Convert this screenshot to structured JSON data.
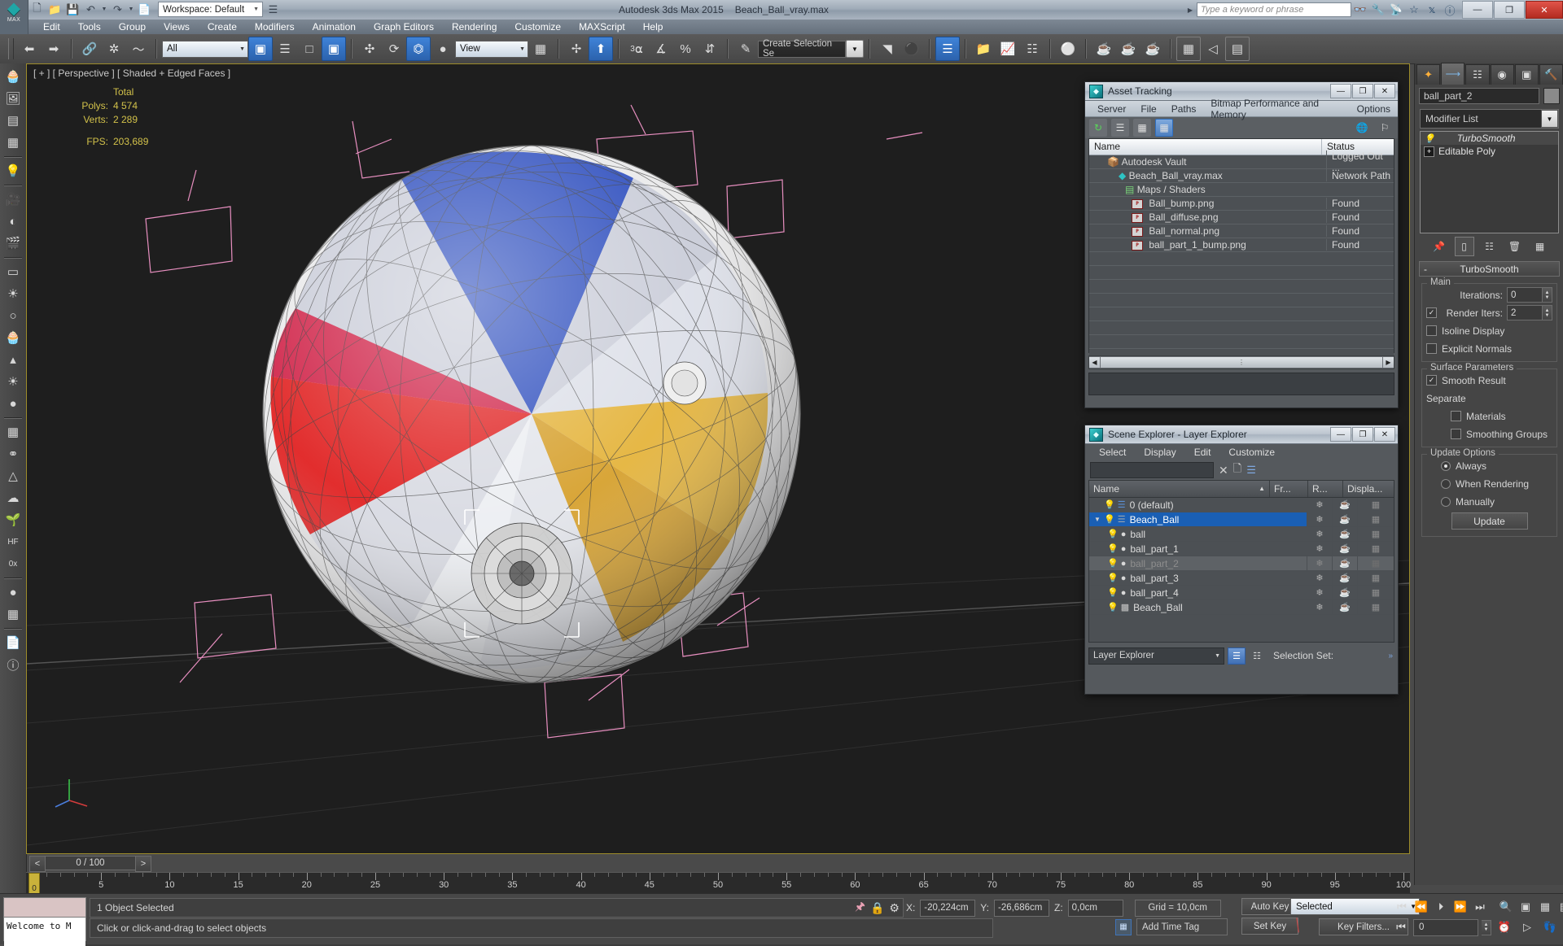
{
  "titlebar": {
    "logo_label": "MAX",
    "workspace": "Workspace: Default",
    "app_title": "Autodesk 3ds Max  2015",
    "file_title": "Beach_Ball_vray.max",
    "search_placeholder": "Type a keyword or phrase",
    "quick_icons": [
      "new-icon",
      "open-icon",
      "save-icon",
      "undo-icon",
      "redo-icon",
      "set-project-icon"
    ],
    "right_icons": [
      "binoculars-icon",
      "wrench-icon",
      "satellite-icon",
      "star-icon",
      "exchange-icon",
      "help-icon"
    ],
    "window_buttons": {
      "minimize": "—",
      "maximize": "❐",
      "close": "✕"
    }
  },
  "menubar": {
    "items": [
      "Edit",
      "Tools",
      "Group",
      "Views",
      "Create",
      "Modifiers",
      "Animation",
      "Graph Editors",
      "Rendering",
      "Customize",
      "MAXScript",
      "Help"
    ]
  },
  "toolbar": {
    "selection_filter": "All",
    "ref_coord_system": "View",
    "named_selection_sets": "Create Selection Se",
    "snap_degree": "3",
    "percent": "%"
  },
  "viewport": {
    "label": "[ + ] [ Perspective ] [ Shaded + Edged Faces ]",
    "stats_header": "Total",
    "stats": [
      {
        "label": "Polys:",
        "value": "4 574"
      },
      {
        "label": "Verts:",
        "value": "2 289"
      }
    ],
    "fps_label": "FPS:",
    "fps_value": "203,689"
  },
  "asset_tracking": {
    "title": "Asset Tracking",
    "menu": [
      "Server",
      "File",
      "Paths",
      "Bitmap Performance and Memory",
      "Options"
    ],
    "columns": [
      "Name",
      "Status"
    ],
    "rows": [
      {
        "name": "Autodesk Vault",
        "status": "Logged Out ...",
        "indent": 1,
        "icon": "vault-icon"
      },
      {
        "name": "Beach_Ball_vray.max",
        "status": "Network Path",
        "indent": 2,
        "icon": "max-file-icon"
      },
      {
        "name": "Maps / Shaders",
        "status": "",
        "indent": 2,
        "icon": "maps-icon"
      },
      {
        "name": "Ball_bump.png",
        "status": "Found",
        "indent": 3,
        "icon": "png-icon"
      },
      {
        "name": "Ball_diffuse.png",
        "status": "Found",
        "indent": 3,
        "icon": "png-icon"
      },
      {
        "name": "Ball_normal.png",
        "status": "Found",
        "indent": 3,
        "icon": "png-icon"
      },
      {
        "name": "ball_part_1_bump.png",
        "status": "Found",
        "indent": 3,
        "icon": "png-icon"
      }
    ],
    "window_buttons": {
      "minimize": "—",
      "maximize": "❐",
      "close": "✕"
    }
  },
  "scene_explorer": {
    "title": "Scene Explorer - Layer Explorer",
    "menu": [
      "Select",
      "Display",
      "Edit",
      "Customize"
    ],
    "filter_value": "",
    "columns": [
      "Name",
      "Fr...",
      "R...",
      "Displa..."
    ],
    "rows": [
      {
        "name": "0 (default)",
        "type": "layer",
        "indent": 1,
        "selected": false,
        "dimmed": false,
        "expander": ""
      },
      {
        "name": "Beach_Ball",
        "type": "layer",
        "indent": 0,
        "selected": true,
        "dimmed": false,
        "expander": "▼"
      },
      {
        "name": "ball",
        "type": "object",
        "indent": 2,
        "selected": false,
        "dimmed": false,
        "expander": ""
      },
      {
        "name": "ball_part_1",
        "type": "object",
        "indent": 2,
        "selected": false,
        "dimmed": false,
        "expander": ""
      },
      {
        "name": "ball_part_2",
        "type": "object",
        "indent": 2,
        "selected": false,
        "dimmed": true,
        "expander": ""
      },
      {
        "name": "ball_part_3",
        "type": "object",
        "indent": 2,
        "selected": false,
        "dimmed": false,
        "expander": ""
      },
      {
        "name": "ball_part_4",
        "type": "object",
        "indent": 2,
        "selected": false,
        "dimmed": false,
        "expander": ""
      },
      {
        "name": "Beach_Ball",
        "type": "group",
        "indent": 2,
        "selected": false,
        "dimmed": false,
        "expander": ""
      }
    ],
    "footer_dropdown": "Layer Explorer",
    "footer_selection_set_label": "Selection Set:",
    "window_buttons": {
      "minimize": "—",
      "maximize": "❐",
      "close": "✕"
    }
  },
  "command_panel": {
    "tabs": [
      "create-tab",
      "modify-tab",
      "hierarchy-tab",
      "motion-tab",
      "display-tab",
      "utilities-tab"
    ],
    "active_tab_index": 1,
    "object_name": "ball_part_2",
    "modifier_list_label": "Modifier List",
    "modifier_stack": [
      {
        "label": "TurboSmooth",
        "italic": true
      },
      {
        "label": "Editable Poly",
        "italic": false
      }
    ],
    "rollout": {
      "title": "TurboSmooth",
      "collapse_sign": "-",
      "groups": [
        {
          "title": "Main",
          "rows": [
            {
              "type": "spinner",
              "label": "Iterations:",
              "value": "0",
              "checked": null
            },
            {
              "type": "spinner",
              "label": "Render Iters:",
              "value": "2",
              "checked": true
            },
            {
              "type": "check",
              "label": "Isoline Display",
              "checked": false
            },
            {
              "type": "check",
              "label": "Explicit Normals",
              "checked": false
            }
          ]
        },
        {
          "title": "Surface Parameters",
          "rows": [
            {
              "type": "check",
              "label": "Smooth Result",
              "checked": true
            },
            {
              "type": "text",
              "label": "Separate"
            },
            {
              "type": "check",
              "label": "Materials",
              "checked": false,
              "sub": true
            },
            {
              "type": "check",
              "label": "Smoothing Groups",
              "checked": false,
              "sub": true
            }
          ]
        },
        {
          "title": "Update Options",
          "rows": [
            {
              "type": "radio",
              "label": "Always",
              "checked": true
            },
            {
              "type": "radio",
              "label": "When Rendering",
              "checked": false
            },
            {
              "type": "radio",
              "label": "Manually",
              "checked": false
            }
          ],
          "button": "Update"
        }
      ]
    }
  },
  "timeline": {
    "current_frame_display": "0 / 100",
    "prev_label": "<",
    "next_label": ">",
    "ticks": [
      0,
      5,
      10,
      15,
      20,
      25,
      30,
      35,
      40,
      45,
      50,
      55,
      60,
      65,
      70,
      75,
      80,
      85,
      90,
      95,
      100
    ],
    "playhead_label": "0"
  },
  "statusbar": {
    "maxscript_mini_listener": "Welcome to M",
    "selection_status": "1 Object Selected",
    "prompt": "Click or click-and-drag to select objects",
    "coords": [
      {
        "axis": "X:",
        "value": "-20,224cm"
      },
      {
        "axis": "Y:",
        "value": "-26,686cm"
      },
      {
        "axis": "Z:",
        "value": "0,0cm"
      }
    ],
    "grid_label": "Grid = 10,0cm",
    "add_time_tag": "Add Time Tag",
    "auto_key": "Auto Key",
    "set_key": "Set Key",
    "key_mode_selected": "Selected",
    "key_filters": "Key Filters...",
    "frame_value": "0"
  },
  "colors": {
    "accent_blue": "#1a5fb4",
    "viewport_border": "#9d8c2a",
    "stats_yellow": "#d2c14a",
    "ball_red": "#e02020",
    "ball_crimson": "#cf1f46",
    "ball_blue": "#2a4bbd",
    "ball_yellow": "#e4b33a",
    "ball_white": "#e9e9ea"
  }
}
